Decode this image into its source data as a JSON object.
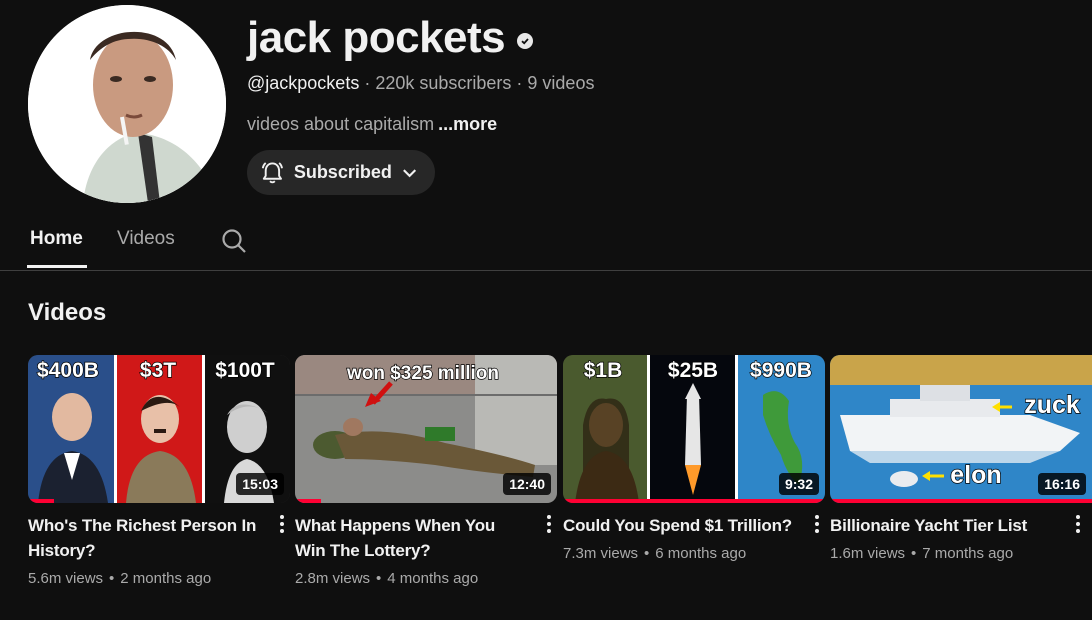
{
  "channel": {
    "name": "jack pockets",
    "handle": "@jackpockets",
    "subscribers": "220k subscribers",
    "video_count": "9 videos",
    "description": "videos about capitalism",
    "more_label": "...more",
    "subscribe_label": "Subscribed"
  },
  "tabs": [
    {
      "label": "Home",
      "active": true
    },
    {
      "label": "Videos",
      "active": false
    }
  ],
  "section_title": "Videos",
  "videos": [
    {
      "title": "Who's The Richest Person In History?",
      "views": "5.6m views",
      "age": "2 months ago",
      "duration": "15:03",
      "watched_fraction": 0.1,
      "thumb_labels": [
        "$400B",
        "$3T",
        "$100T"
      ]
    },
    {
      "title": "What Happens When You Win The Lottery?",
      "views": "2.8m views",
      "age": "4 months ago",
      "duration": "12:40",
      "watched_fraction": 0.1,
      "thumb_labels": [
        "won $325 million"
      ]
    },
    {
      "title": "Could You Spend $1 Trillion?",
      "views": "7.3m views",
      "age": "6 months ago",
      "duration": "9:32",
      "watched_fraction": 1.0,
      "thumb_labels": [
        "$1B",
        "$25B",
        "$990B"
      ]
    },
    {
      "title": "Billionaire Yacht Tier List",
      "views": "1.6m views",
      "age": "7 months ago",
      "duration": "16:16",
      "watched_fraction": 1.0,
      "thumb_labels": [
        "zuck",
        "elon"
      ]
    }
  ],
  "colors": {
    "background": "#0f0f0f",
    "text_primary": "#f1f1f1",
    "text_secondary": "#aaaaaa",
    "button_bg": "#272727",
    "progress_red": "#ff0033"
  },
  "icons": {
    "verified": "verified-check-icon",
    "bell": "bell-icon",
    "chevron": "chevron-down-icon",
    "search": "search-icon",
    "more": "kebab-menu-icon"
  }
}
